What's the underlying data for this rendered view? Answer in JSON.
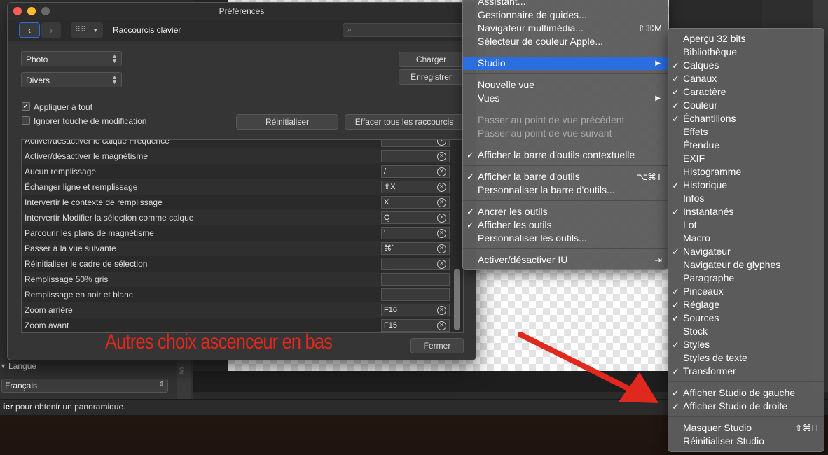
{
  "status_bar": {
    "bold": "ier",
    "text": " pour obtenir un panoramique."
  },
  "left_panel": {
    "langue_label": "Langue",
    "langue_value": "Français",
    "ruler_label": "90"
  },
  "dialog": {
    "title": "Préférences",
    "section": "Raccourcis clavier",
    "category_select": "Photo",
    "subcategory_select": "Divers",
    "load_button": "Charger",
    "save_button": "Enregistrer",
    "apply_all_label": "Appliquer à tout",
    "apply_all_checked": true,
    "ignore_modifier_label": "Ignorer touche de modification",
    "ignore_modifier_checked": false,
    "reset_button": "Réinitialiser",
    "clear_all_button": "Effacer tous les raccourcis",
    "close_button": "Fermer",
    "shortcuts": [
      {
        "label": "Activer/désactiver le calque Fréquence",
        "key": "",
        "clear": true
      },
      {
        "label": "Activer/désactiver le magnétisme",
        "key": ";",
        "clear": true
      },
      {
        "label": "Aucun remplissage",
        "key": "/",
        "clear": true
      },
      {
        "label": "Échanger ligne et remplissage",
        "key": "⇧X",
        "clear": true
      },
      {
        "label": "Intervertir le contexte de remplissage",
        "key": "X",
        "clear": true
      },
      {
        "label": "Intervertir Modifier la sélection comme calque",
        "key": "Q",
        "clear": true
      },
      {
        "label": "Parcourir les plans de magnétisme",
        "key": "'",
        "clear": true
      },
      {
        "label": "Passer à la vue suivante",
        "key": "⌘`",
        "clear": true
      },
      {
        "label": "Réinitialiser le cadre de sélection",
        "key": ".",
        "clear": true
      },
      {
        "label": "Remplissage 50% gris",
        "key": "",
        "clear": false
      },
      {
        "label": "Remplissage en noir et blanc",
        "key": "",
        "clear": false
      },
      {
        "label": "Zoom arrière",
        "key": "F16",
        "clear": true
      },
      {
        "label": "Zoom avant",
        "key": "F15",
        "clear": true
      }
    ]
  },
  "annotation": "Autres choix ascenceur en bas",
  "main_menu": {
    "items": [
      {
        "label": "Assistant...",
        "type": "item"
      },
      {
        "label": "Gestionnaire de guides...",
        "type": "item"
      },
      {
        "label": "Navigateur multimédia...",
        "shortcut": "⇧⌘M",
        "type": "item"
      },
      {
        "label": "Sélecteur de couleur Apple...",
        "type": "item"
      },
      {
        "type": "sep"
      },
      {
        "label": "Studio",
        "type": "submenu",
        "highlighted": true
      },
      {
        "type": "sep"
      },
      {
        "label": "Nouvelle vue",
        "type": "item"
      },
      {
        "label": "Vues",
        "type": "submenu"
      },
      {
        "type": "sep"
      },
      {
        "label": "Passer au point de vue précédent",
        "type": "disabled"
      },
      {
        "label": "Passer au point de vue suivant",
        "type": "disabled"
      },
      {
        "type": "sep"
      },
      {
        "label": "Afficher la barre d'outils contextuelle",
        "checked": true,
        "type": "item"
      },
      {
        "type": "sep"
      },
      {
        "label": "Afficher la barre d'outils",
        "checked": true,
        "shortcut": "⌥⌘T",
        "type": "item"
      },
      {
        "label": "Personnaliser la barre d'outils...",
        "type": "item"
      },
      {
        "type": "sep"
      },
      {
        "label": "Ancrer les outils",
        "checked": true,
        "type": "item"
      },
      {
        "label": "Afficher les outils",
        "checked": true,
        "type": "item"
      },
      {
        "label": "Personnaliser les outils...",
        "type": "item"
      },
      {
        "type": "sep"
      },
      {
        "label": "Activer/désactiver IU",
        "shortcut": "⇥",
        "type": "item"
      }
    ]
  },
  "studio_menu": {
    "items": [
      {
        "label": "Aperçu 32 bits",
        "checked": false
      },
      {
        "label": "Bibliothèque",
        "checked": false
      },
      {
        "label": "Calques",
        "checked": true
      },
      {
        "label": "Canaux",
        "checked": true
      },
      {
        "label": "Caractère",
        "checked": true
      },
      {
        "label": "Couleur",
        "checked": true
      },
      {
        "label": "Échantillons",
        "checked": true
      },
      {
        "label": "Effets",
        "checked": false
      },
      {
        "label": "Étendue",
        "checked": false
      },
      {
        "label": "EXIF",
        "checked": false
      },
      {
        "label": "Histogramme",
        "checked": false
      },
      {
        "label": "Historique",
        "checked": true
      },
      {
        "label": "Infos",
        "checked": false
      },
      {
        "label": "Instantanés",
        "checked": true
      },
      {
        "label": "Lot",
        "checked": false
      },
      {
        "label": "Macro",
        "checked": false
      },
      {
        "label": "Navigateur",
        "checked": true
      },
      {
        "label": "Navigateur de glyphes",
        "checked": false
      },
      {
        "label": "Paragraphe",
        "checked": false
      },
      {
        "label": "Pinceaux",
        "checked": true
      },
      {
        "label": "Réglage",
        "checked": true
      },
      {
        "label": "Sources",
        "checked": true
      },
      {
        "label": "Stock",
        "checked": false
      },
      {
        "label": "Styles",
        "checked": true
      },
      {
        "label": "Styles de texte",
        "checked": false
      },
      {
        "label": "Transformer",
        "checked": true
      }
    ],
    "studio_sides": [
      {
        "label": "Afficher Studio de gauche",
        "checked": true
      },
      {
        "label": "Afficher Studio de droite",
        "checked": true
      }
    ],
    "bottom": [
      {
        "label": "Masquer Studio",
        "shortcut": "⇧⌘H"
      },
      {
        "label": "Réinitialiser Studio"
      }
    ]
  },
  "colors": {
    "highlight": "#2a6ee0",
    "annotation_red": "#e0281e"
  }
}
